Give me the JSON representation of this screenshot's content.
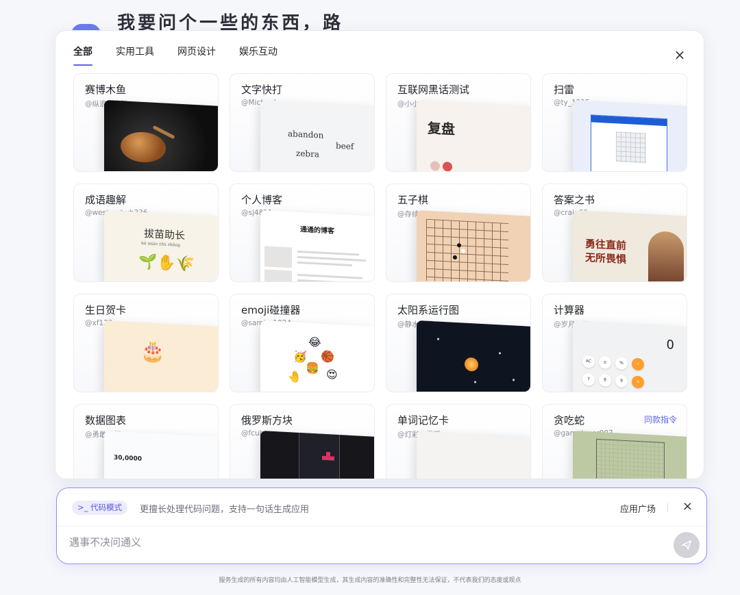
{
  "background_title": "我要问个一些的东西，路罢",
  "tabs": [
    {
      "label": "全部",
      "active": true
    },
    {
      "label": "实用工具"
    },
    {
      "label": "网页设计"
    },
    {
      "label": "娱乐互动"
    }
  ],
  "panel_close_icon": "×",
  "cards": [
    {
      "title": "赛博木鱼",
      "author": "@纵浪小分队",
      "thumb": "wooden-fish"
    },
    {
      "title": "文字快打",
      "author": "@Micheal",
      "thumb": "typing",
      "words": [
        "abandon",
        "beef",
        "zebra"
      ]
    },
    {
      "title": "互联网黑话测试",
      "author": "@小小白",
      "thumb": "review",
      "big": "复盘"
    },
    {
      "title": "扫雷",
      "author": "@ty_1215",
      "thumb": "minesweeper"
    },
    {
      "title": "成语趣解",
      "author": "@westsurbub336",
      "thumb": "idiom",
      "big": "拔苗助长",
      "pinyin": "bá miáo zhù zhǎng"
    },
    {
      "title": "个人博客",
      "author": "@sj4811",
      "thumb": "blog",
      "big": "通通的博客"
    },
    {
      "title": "五子棋",
      "author": "@存续123",
      "thumb": "gomoku"
    },
    {
      "title": "答案之书",
      "author": "@crain66",
      "thumb": "answer",
      "big": "勇往直前\n无所畏惧"
    },
    {
      "title": "生日贺卡",
      "author": "@xf123",
      "thumb": "cake"
    },
    {
      "title": "emoji碰撞器",
      "author": "@samira1024",
      "thumb": "emoji"
    },
    {
      "title": "太阳系运行图",
      "author": "@静水流深",
      "thumb": "solar"
    },
    {
      "title": "计算器",
      "author": "@岁月静好",
      "thumb": "calculator",
      "display": "0"
    },
    {
      "title": "数据图表",
      "author": "@勇敢前行",
      "thumb": "chart",
      "big": "30,0000"
    },
    {
      "title": "俄罗斯方块",
      "author": "@fcubeee",
      "thumb": "tetris"
    },
    {
      "title": "单词记忆卡",
      "author": "@灯彩路雾孬",
      "thumb": "vocab"
    },
    {
      "title": "贪吃蛇",
      "author": "@gamelover007",
      "thumb": "snake",
      "tag": "同款指令"
    }
  ],
  "input": {
    "mode_chip": ">_ 代码模式",
    "mode_desc": "更擅长处理代码问题，支持一句话生成应用",
    "plaza": "应用广场",
    "close": "×",
    "placeholder": "遇事不决问通义"
  },
  "disclaimer": "服务生成的所有内容均由人工智能模型生成，其生成内容的准确性和完整性无法保证，不代表我们的态度或观点",
  "colors": {
    "accent": "#5b63f0",
    "input_border": "#8f8ff0"
  }
}
